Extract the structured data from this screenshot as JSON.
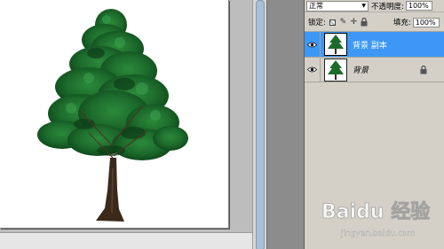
{
  "layers_panel": {
    "blend_mode": "正常",
    "opacity_label": "不透明度:",
    "opacity_value": "100%",
    "lock_label": "锁定:",
    "fill_label": "填充:",
    "fill_value": "100%",
    "layers": [
      {
        "name": "背景 副本",
        "visible": true,
        "selected": true
      },
      {
        "name": "背景",
        "visible": true,
        "selected": false,
        "locked": true
      }
    ]
  },
  "icons": {
    "visibility": "eye-icon",
    "lock_transparent": "lock-transparent-pixels-icon",
    "lock_image": "brush-icon",
    "lock_position": "move-icon",
    "lock_all": "padlock-icon"
  },
  "watermark": {
    "text": "Baidu 经验",
    "url": "jingyan.baidu.com"
  },
  "colors": {
    "selection": "#3d98f5",
    "panel_bg": "#d4d0c8",
    "tree_foliage": "#1f6b2a",
    "tree_trunk": "#3b2a1a"
  }
}
